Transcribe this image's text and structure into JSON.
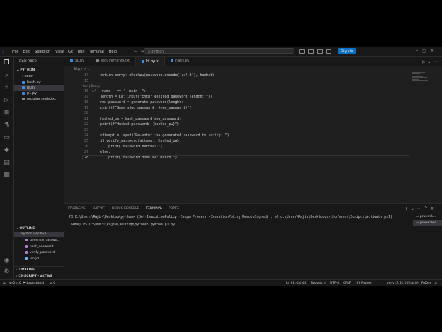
{
  "menu": [
    "File",
    "Edit",
    "Selection",
    "View",
    "Go",
    "Run",
    "Terminal",
    "Help"
  ],
  "command_center": "python",
  "signin_label": "Sign in",
  "explorer": {
    "title": "EXPLORER",
    "root": "PYTHON",
    "items": [
      {
        "label": "venv",
        "icon": "folder-icon"
      },
      {
        "label": "hash.py",
        "icon": "python-file-icon"
      },
      {
        "label": "hi.py",
        "icon": "python-file-icon"
      },
      {
        "label": "p1.py",
        "icon": "python-file-icon"
      },
      {
        "label": "requirements.txt",
        "icon": "text-file-icon"
      }
    ],
    "selected_index": 2
  },
  "outline": {
    "title": "OUTLINE",
    "group": "Python (PyDev)",
    "items": [
      "generate_passwo...",
      "hash_password",
      "verify_password",
      "length"
    ]
  },
  "timeline_title": "TIMELINE",
  "cs_script_title": "CS-SCRIPT - ACTIVE",
  "tabs": [
    {
      "label": "p1.py",
      "icon": "python"
    },
    {
      "label": "requirements.txt",
      "icon": "text"
    },
    {
      "label": "hi.py",
      "icon": "python",
      "active": true
    },
    {
      "label": "hash.py",
      "icon": "python"
    }
  ],
  "breadcrumb": "hi.py > ...",
  "codelens": "Run | Debug",
  "code_lines": [
    {
      "n": "14",
      "text": "    return bcrypt.checkpw(password.encode('utf-8'), hashed)"
    },
    {
      "n": "15",
      "text": ""
    },
    {
      "n": "16",
      "text": "if __name__ == \"__main__\":"
    },
    {
      "n": "17",
      "text": "    length = int(input(\"Enter desired password length: \"))"
    },
    {
      "n": "18",
      "text": "    new_password = generate_password(length)"
    },
    {
      "n": "19",
      "text": "    print(f\"Generated password: {new_password}\")"
    },
    {
      "n": "20",
      "text": ""
    },
    {
      "n": "21",
      "text": "    hashed_pw = hash_password(new_password)"
    },
    {
      "n": "22",
      "text": "    print(f\"Hashed password: {hashed_pw}\")"
    },
    {
      "n": "23",
      "text": ""
    },
    {
      "n": "24",
      "text": "    attempt = input(\"Re-enter the generated password to verify: \")"
    },
    {
      "n": "25",
      "text": "    if verify_password(attempt, hashed_pw):"
    },
    {
      "n": "26",
      "text": "        print(\"Password matches!\")"
    },
    {
      "n": "27",
      "text": "    else:"
    },
    {
      "n": "28",
      "text": "        print(\"Password does not match.\")"
    }
  ],
  "panel": {
    "tabs": [
      "PROBLEMS",
      "OUTPUT",
      "DEBUG CONSOLE",
      "TERMINAL",
      "PORTS"
    ],
    "active_tab": "TERMINAL",
    "terminal_lines": [
      "PS C:\\Users\\Rajiv\\Desktop\\python> (Set-ExecutionPolicy -Scope Process -ExecutionPolicy RemoteSigned) ; (& c:\\Users\\Rajiv\\Desktop\\python\\venv\\Scripts\\Activate.ps1)",
      "(venv) PS C:\\Users\\Rajiv\\Desktop\\python> python p1.py"
    ],
    "terminals": [
      "powersh...",
      "powershell"
    ]
  },
  "status": {
    "errors": "0",
    "warnings": "0",
    "launchpad": "Launchpad",
    "ports": "0",
    "position": "Ln 28, Col 42",
    "spaces": "Spaces: 4",
    "encoding": "UTF-8",
    "eol": "CRLF",
    "language": "Python",
    "interpreter": "venv (3.14.0.final.0)",
    "pydev": "PyDev"
  },
  "colors": {
    "accent": "#0078d4",
    "signin": "#0e70c0",
    "editor_bg": "#1f1f1f",
    "sidebar_bg": "#181818"
  }
}
